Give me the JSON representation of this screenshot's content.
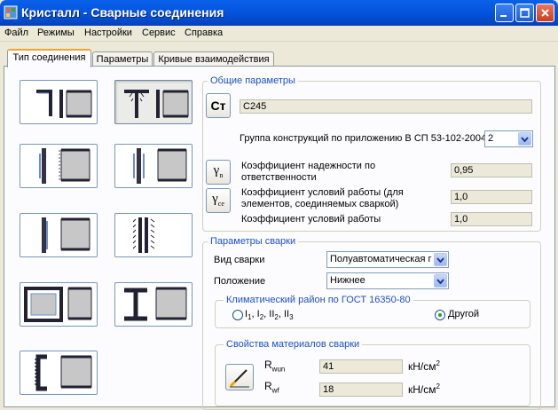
{
  "window": {
    "title": "Кристалл - Сварные соединения"
  },
  "menu": [
    "Файл",
    "Режимы",
    "Настройки",
    "Сервис",
    "Справка"
  ],
  "tabs": [
    "Тип соединения",
    "Параметры",
    "Кривые взаимодействия"
  ],
  "general": {
    "title": "Общие параметры",
    "steel_button": "Ст",
    "steel_value": "С245",
    "group_label": "Группа конструкций по приложению В СП 53-102-2004",
    "group_value": "2",
    "reliability_label_1": "Коэффициент надежности по",
    "reliability_label_2": "ответственности",
    "reliability_value": "0,95",
    "reliability_symbol": "γ",
    "reliability_sub": "n",
    "work_cond_label_1": "Коэффициент условий работы (для",
    "work_cond_label_2": "элементов, соединяемых сваркой)",
    "work_cond_value": "1,0",
    "work_cond_symbol": "γ",
    "work_cond_sub": "ce",
    "work_cond2_label": "Коэффициент условий работы",
    "work_cond2_value": "1,0"
  },
  "welding": {
    "title": "Параметры сварки",
    "type_label": "Вид сварки",
    "type_value": "Полуавтоматическая г",
    "position_label": "Положение",
    "position_value": "Нижнее",
    "climate_title": "Климатический район по ГОСТ 16350-80",
    "climate_option1": {
      "base": "I",
      "items": [
        "1",
        "2",
        "3"
      ]
    },
    "climate_option2": "Другой",
    "materials_title": "Свойства материалов сварки",
    "rwun_symbol": "R",
    "rwun_sub": "wun",
    "rwun_value": "41",
    "rwf_symbol": "R",
    "rwf_sub": "wf",
    "rwf_value": "18",
    "unit_base": "кН/см",
    "unit_exp": "2"
  },
  "colors": {
    "accent": "#1c4fc6",
    "titlebar": "#0556e0",
    "tab_active": "#f7a22b"
  }
}
